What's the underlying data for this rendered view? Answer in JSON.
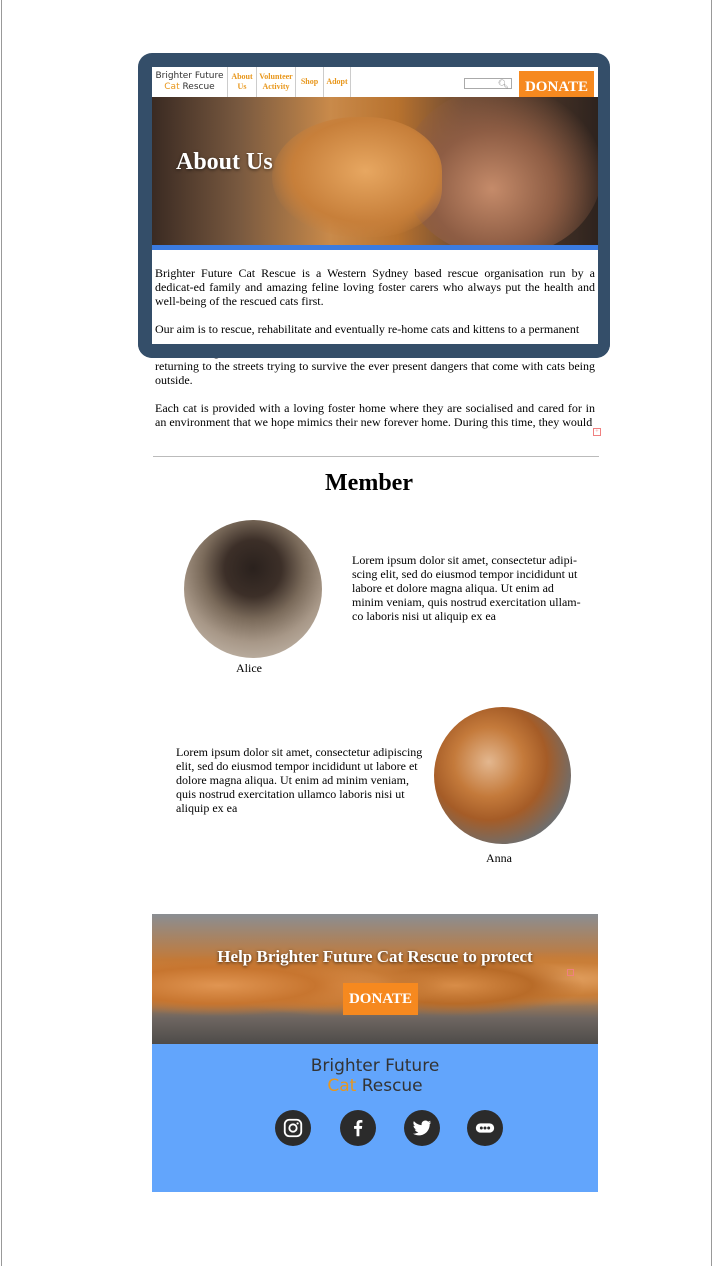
{
  "brand": {
    "name_line1": "Brighter Future",
    "name_cat": "Cat",
    "name_rescue": " Rescue"
  },
  "nav": {
    "items": [
      {
        "label": "About Us"
      },
      {
        "label": "Volunteer Activity"
      },
      {
        "label": "Shop"
      },
      {
        "label": "Adopt"
      }
    ],
    "donate_label": "DONATE"
  },
  "hero": {
    "title": "About Us"
  },
  "about": {
    "p1": "Brighter Future Cat Rescue is a Western Sydney based rescue organisation run by a dedicat-ed family and amazing feline loving foster carers who always put the health and well-being of the rescued cats first.",
    "p2_visible": "Our aim is to rescue, rehabilitate and eventually re-home cats and kittens to a permanent",
    "p2_overflow": "secure loving environment for the cats and kittens but would also minimise the risk of them returning to the streets trying to survive the ever present dangers that come with cats being outside.",
    "p3": "Each cat is provided with a loving foster home where they are socialised and cared for in an environment that we hope mimics their new forever home. During this time, they would"
  },
  "members": {
    "title": "Member",
    "list": [
      {
        "name": "Alice",
        "bio": "Lorem ipsum dolor sit amet, consectetur adipi-scing elit, sed do eiusmod tempor incididunt ut labore et dolore magna aliqua. Ut enim ad minim veniam, quis nostrud exercitation ullam-co laboris nisi ut aliquip ex ea"
      },
      {
        "name": "Anna",
        "bio": "Lorem ipsum dolor sit amet, consectetur adipiscing elit, sed do eiusmod tempor incididunt ut labore et dolore magna aliqua. Ut enim ad minim veniam, quis nostrud exercitation ullamco laboris nisi ut aliquip ex ea"
      }
    ]
  },
  "banner": {
    "text": "Help Brighter Future Cat Rescue to protect",
    "donate_label": "DONATE"
  },
  "footer": {
    "social": [
      {
        "icon": "instagram-icon"
      },
      {
        "icon": "facebook-icon"
      },
      {
        "icon": "twitter-icon"
      },
      {
        "icon": "more-icon"
      }
    ]
  },
  "colors": {
    "accent": "#f6891f",
    "frame": "#344e69",
    "footer": "#62a5fc",
    "hero_bar": "#3b7be0"
  }
}
